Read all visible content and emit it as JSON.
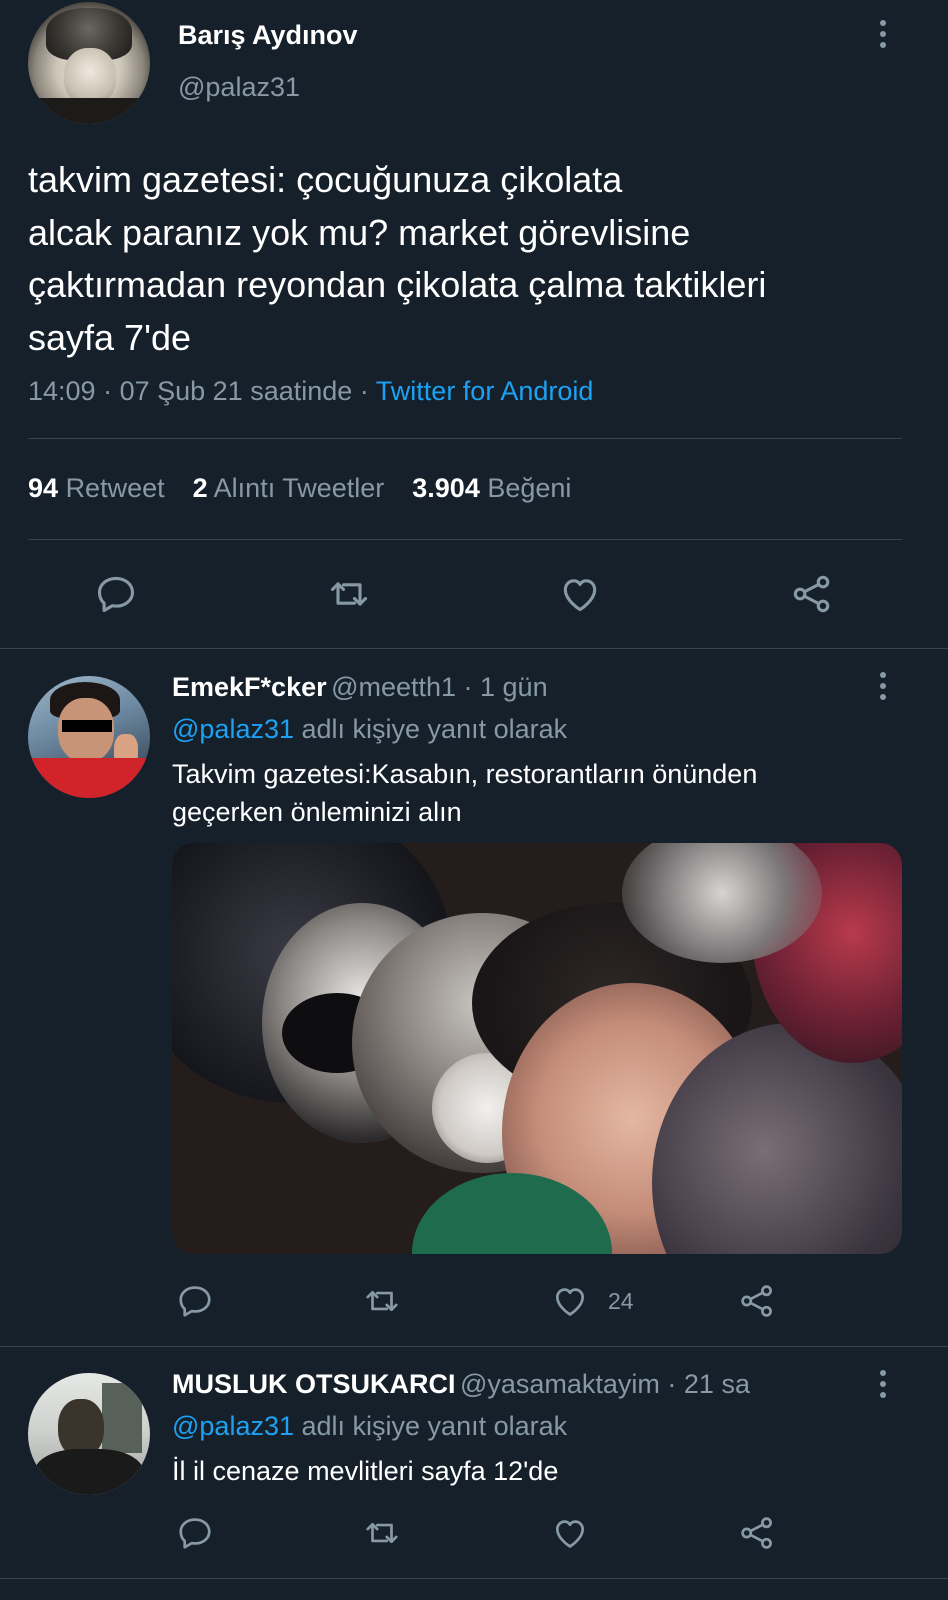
{
  "main_tweet": {
    "author_name": "Barış Aydınov",
    "author_handle": "@palaz31",
    "text": "takvim gazetesi: çocuğunuza çikolata\nalcak paranız yok mu? market görevlisine\nçaktırmadan reyondan çikolata çalma taktikleri\nsayfa 7'de",
    "time": "14:09",
    "separator1": " · ",
    "date": "07 Şub 21 saatinde",
    "separator2": " · ",
    "app": "Twitter for Android",
    "stats": {
      "retweets_count": "94",
      "retweets_label": "Retweet",
      "quotes_count": "2",
      "quotes_label": "Alıntı Tweetler",
      "likes_count": "3.904",
      "likes_label": "Beğeni"
    }
  },
  "replies": [
    {
      "name": "EmekF*cker",
      "handle": "@meetth1",
      "time": " · 1 gün",
      "reply_to_mention": "@palaz31",
      "reply_to_suffix": " adlı kişiye yanıt olarak",
      "text": "Takvim gazetesi:Kasabın, restorantların önünden geçerken önleminizi alın",
      "like_count": "24"
    },
    {
      "name": "MUSLUK OTSUKARCI",
      "handle": "@yasamaktayim",
      "time": " · 21 sa",
      "reply_to_mention": "@palaz31",
      "reply_to_suffix": " adlı kişiye yanıt olarak",
      "text": "İl il cenaze mevlitleri sayfa 12'de"
    }
  ],
  "colors": {
    "background": "#15202b",
    "secondary_text": "#8899a6",
    "link": "#1da1f2",
    "divider": "#38444d"
  },
  "icons": [
    "more-vertical-icon",
    "reply-icon",
    "retweet-icon",
    "like-icon",
    "share-icon"
  ]
}
